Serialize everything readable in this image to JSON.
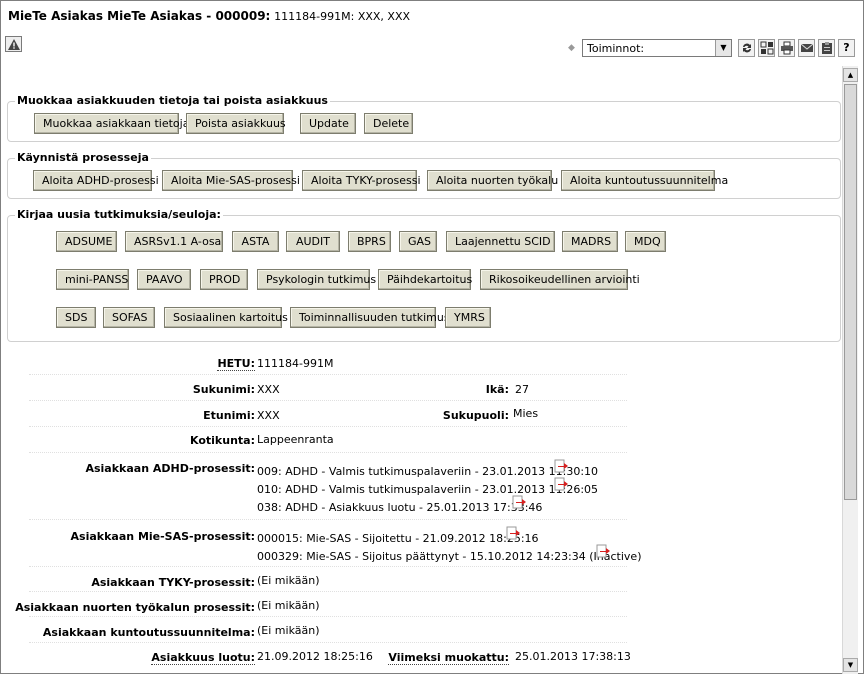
{
  "title": {
    "main": "MieTe Asiakas MieTe Asiakas - 000009:",
    "sub": "111184-991M: XXX, XXX"
  },
  "toolbar": {
    "select_value": "Toiminnot:",
    "icons": [
      "refresh-icon",
      "layout-icon",
      "print-icon",
      "mail-icon",
      "clipboard-icon",
      "help-icon"
    ],
    "help_label": "?"
  },
  "groups": {
    "customer": {
      "legend": "Muokkaa asiakkuuden tietoja tai poista asiakkuus",
      "buttons": [
        "Muokkaa asiakkaan tietoja",
        "Poista asiakkuus",
        "Update",
        "Delete"
      ]
    },
    "processes": {
      "legend": "Käynnistä prosesseja",
      "buttons": [
        "Aloita ADHD-prosessi",
        "Aloita Mie-SAS-prosessi",
        "Aloita TYKY-prosessi",
        "Aloita nuorten työkalu",
        "Aloita kuntoutussuunnitelma"
      ]
    },
    "studies": {
      "legend": "Kirjaa uusia tutkimuksia/seuloja:",
      "row1": [
        "ADSUME",
        "ASRSv1.1 A-osa",
        "ASTA",
        "AUDIT",
        "BPRS",
        "GAS",
        "Laajennettu SCID",
        "MADRS",
        "MDQ"
      ],
      "row2": [
        "mini-PANSS",
        "PAAVO",
        "PROD",
        "Psykologin tutkimus",
        "Päihdekartoitus",
        "Rikosoikeudellinen arviointi"
      ],
      "row3": [
        "SDS",
        "SOFAS",
        "Sosiaalinen kartoitus",
        "Toiminnallisuuden tutkimus",
        "YMRS"
      ]
    }
  },
  "info": {
    "hetu_label": "HETU:",
    "hetu": "111184-991M",
    "sukunimi_label": "Sukunimi:",
    "sukunimi": "XXX",
    "ika_label": "Ikä:",
    "ika": "27",
    "etunimi_label": "Etunimi:",
    "etunimi": "XXX",
    "sukupuoli_label": "Sukupuoli:",
    "sukupuoli": "Mies",
    "kotikunta_label": "Kotikunta:",
    "kotikunta": "Lappeenranta",
    "adhd_label": "Asiakkaan ADHD-prosessit:",
    "adhd": [
      "009: ADHD - Valmis tutkimuspalaveriin - 23.01.2013 11:30:10",
      "010: ADHD - Valmis tutkimuspalaveriin - 23.01.2013 11:26:05",
      "038: ADHD - Asiakkuus luotu - 25.01.2013 17:33:46"
    ],
    "miesas_label": "Asiakkaan Mie-SAS-prosessit:",
    "miesas": [
      "000015: Mie-SAS - Sijoitettu - 21.09.2012 18:25:16",
      "000329: Mie-SAS - Sijoitus päättynyt - 15.10.2012 14:23:34 (Inactive)"
    ],
    "tyky_label": "Asiakkaan TYKY-prosessit:",
    "tyky": "(Ei mikään)",
    "nuorten_label": "Asiakkaan nuorten työkalun prosessit:",
    "nuorten": "(Ei mikään)",
    "kuntoutus_label": "Asiakkaan kuntoutussuunnitelma:",
    "kuntoutus": "(Ei mikään)",
    "luotu_label": "Asiakkuus luotu:",
    "luotu": "21.09.2012 18:25:16",
    "muokattu_label": "Viimeksi muokattu:",
    "muokattu": "25.01.2013 17:38:13"
  }
}
